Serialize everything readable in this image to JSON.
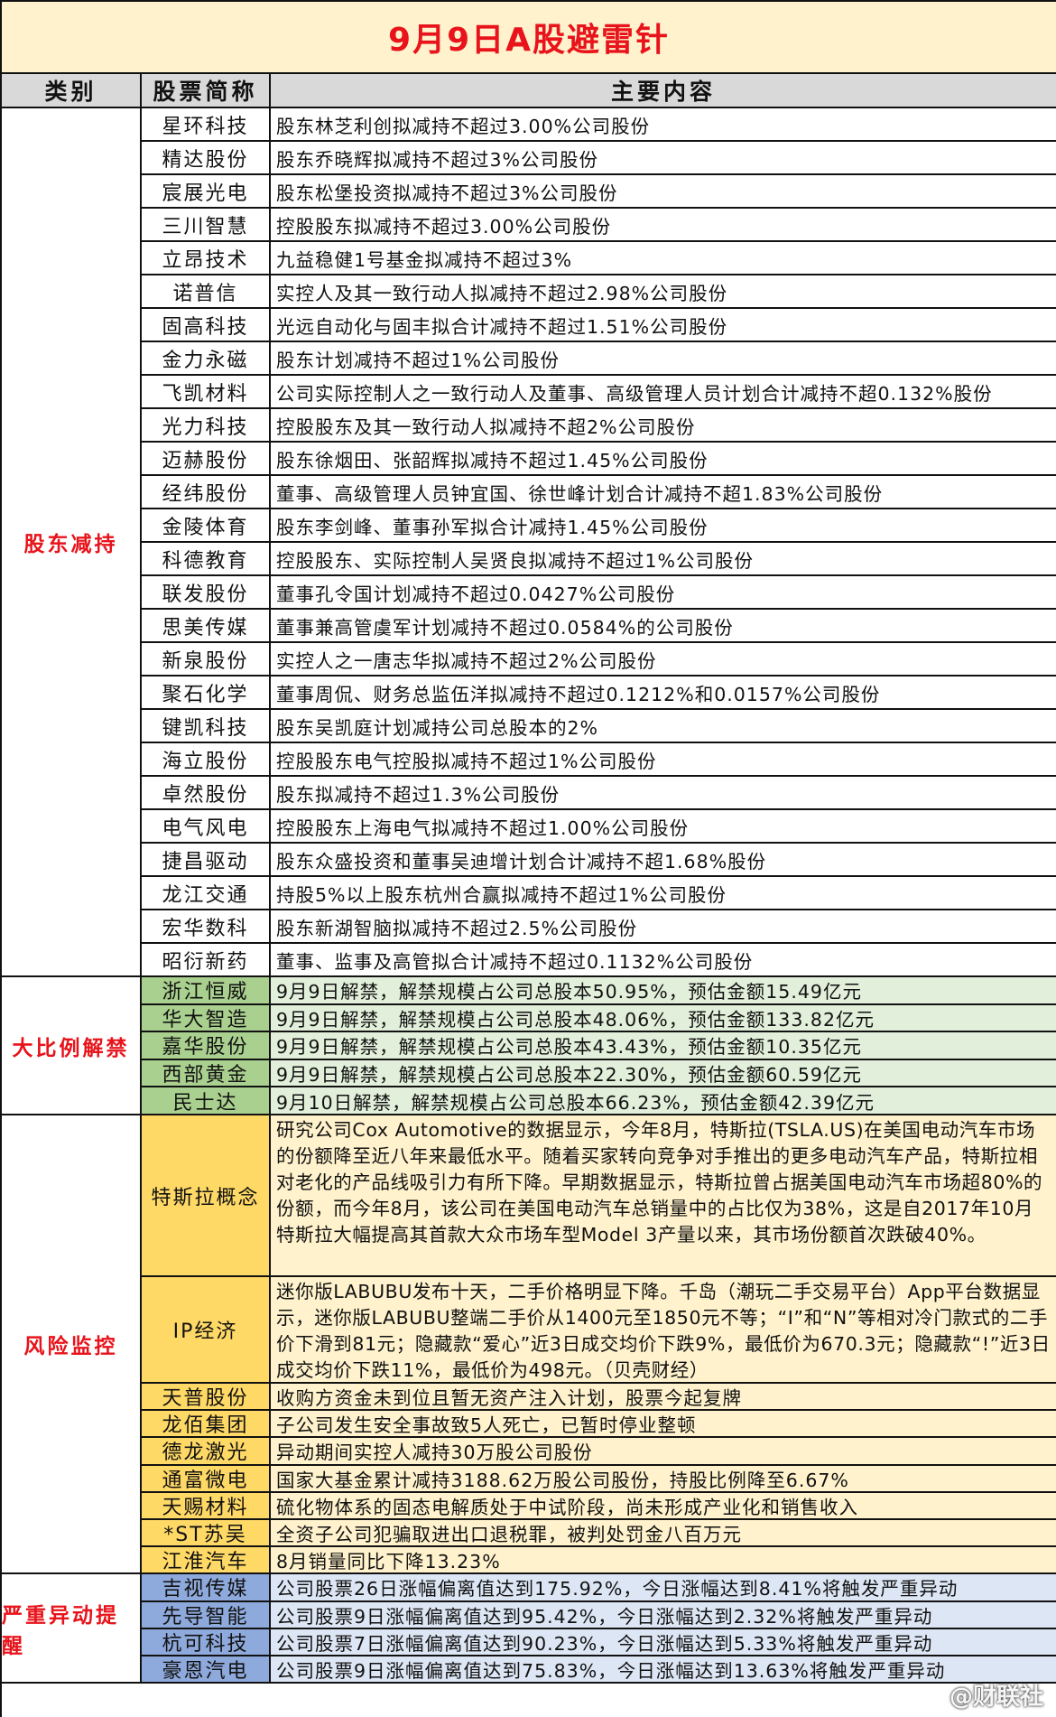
{
  "title": "9月9日A股避雷针",
  "headers": {
    "category": "类别",
    "stock": "股票简称",
    "content": "主要内容"
  },
  "colors": {
    "title_text": "#e8131b",
    "category_text": "#e8131b",
    "header_bg": "#d9d9d9",
    "group_shareholder_bg": "#ffffff",
    "group_unlock_bg": "#a9d08e",
    "group_risk_bg": "#ffd966",
    "group_abnormal_bg": "#8ea9db"
  },
  "groups": [
    {
      "category": "股东减持",
      "rows": [
        {
          "name": "星环科技",
          "content": "股东林芝利创拟减持不超过3.00%公司股份"
        },
        {
          "name": "精达股份",
          "content": "股东乔晓辉拟减持不超过3%公司股份"
        },
        {
          "name": "宸展光电",
          "content": "股东松堡投资拟减持不超过3%公司股份"
        },
        {
          "name": "三川智慧",
          "content": "控股股东拟减持不超过3.00%公司股份"
        },
        {
          "name": "立昂技术",
          "content": "九益稳健1号基金拟减持不超过3%"
        },
        {
          "name": "诺普信",
          "content": "实控人及其一致行动人拟减持不超过2.98%公司股份"
        },
        {
          "name": "固高科技",
          "content": "光远自动化与固丰拟合计减持不超过1.51%公司股份"
        },
        {
          "name": "金力永磁",
          "content": "股东计划减持不超过1%公司股份"
        },
        {
          "name": "飞凯材料",
          "content": "公司实际控制人之一致行动人及董事、高级管理人员计划合计减持不超0.132%股份"
        },
        {
          "name": "光力科技",
          "content": "控股股东及其一致行动人拟减持不超2%公司股份"
        },
        {
          "name": "迈赫股份",
          "content": "股东徐烟田、张韶辉拟减持不超过1.45%公司股份"
        },
        {
          "name": "经纬股份",
          "content": "董事、高级管理人员钟宜国、徐世峰计划合计减持不超1.83%公司股份"
        },
        {
          "name": "金陵体育",
          "content": "股东李剑峰、董事孙军拟合计减持1.45%公司股份"
        },
        {
          "name": "科德教育",
          "content": "控股股东、实际控制人吴贤良拟减持不超过1%公司股份"
        },
        {
          "name": "联发股份",
          "content": "董事孔令国计划减持不超过0.0427%公司股份"
        },
        {
          "name": "思美传媒",
          "content": "董事兼高管虞军计划减持不超过0.0584%的公司股份"
        },
        {
          "name": "新泉股份",
          "content": "实控人之一唐志华拟减持不超过2%公司股份"
        },
        {
          "name": "聚石化学",
          "content": "董事周侃、财务总监伍洋拟减持不超过0.1212%和0.0157%公司股份"
        },
        {
          "name": "键凯科技",
          "content": "股东吴凯庭计划减持公司总股本的2%"
        },
        {
          "name": "海立股份",
          "content": "控股股东电气控股拟减持不超过1%公司股份"
        },
        {
          "name": "卓然股份",
          "content": "股东拟减持不超过1.3%公司股份"
        },
        {
          "name": "电气风电",
          "content": "控股股东上海电气拟减持不超过1.00%公司股份"
        },
        {
          "name": "捷昌驱动",
          "content": "股东众盛投资和董事吴迪增计划合计减持不超1.68%股份"
        },
        {
          "name": "龙江交通",
          "content": "持股5%以上股东杭州合赢拟减持不超过1%公司股份"
        },
        {
          "name": "宏华数科",
          "content": "股东新湖智脑拟减持不超过2.5%公司股份"
        },
        {
          "name": "昭衍新药",
          "content": "董事、监事及高管拟合计减持不超过0.1132%公司股份"
        }
      ]
    },
    {
      "category": "大比例解禁",
      "rows": [
        {
          "name": "浙江恒威",
          "content": "9月9日解禁，解禁规模占公司总股本50.95%，预估金额15.49亿元"
        },
        {
          "name": "华大智造",
          "content": "9月9日解禁，解禁规模占公司总股本48.06%，预估金额133.82亿元"
        },
        {
          "name": "嘉华股份",
          "content": "9月9日解禁，解禁规模占公司总股本43.43%，预估金额10.35亿元"
        },
        {
          "name": "西部黄金",
          "content": "9月9日解禁，解禁规模占公司总股本22.30%，预估金额60.59亿元"
        },
        {
          "name": "民士达",
          "content": "9月10日解禁，解禁规模占公司总股本66.23%，预估金额42.39亿元"
        }
      ]
    },
    {
      "category": "风险监控",
      "rows": [
        {
          "name": "特斯拉概念",
          "content": "研究公司Cox Automotive的数据显示，今年8月，特斯拉(TSLA.US)在美国电动汽车市场的份额降至近八年来最低水平。随着买家转向竞争对手推出的更多电动汽车产品，特斯拉相对老化的产品线吸引力有所下降。早期数据显示，特斯拉曾占据美国电动汽车市场超80%的份额，而今年8月，该公司在美国电动汽车总销量中的占比仅为38%，这是自2017年10月特斯拉大幅提高其首款大众市场车型Model 3产量以来，其市场份额首次跌破40%。"
        },
        {
          "name": "IP经济",
          "content": "迷你版LABUBU发布十天，二手价格明显下降。千岛（潮玩二手交易平台）App平台数据显示，迷你版LABUBU整端二手价从1400元至1850元不等；“I”和“N”等相对冷门款式的二手价下滑到81元；隐藏款“爱心”近3日成交均价下跌9%，最低价为670.3元；隐藏款“!”近3日成交均价下跌11%，最低价为498元。（贝壳财经）"
        },
        {
          "name": "天普股份",
          "content": "收购方资金未到位且暂无资产注入计划，股票今起复牌"
        },
        {
          "name": "龙佰集团",
          "content": "子公司发生安全事故致5人死亡，已暂时停业整顿"
        },
        {
          "name": "德龙激光",
          "content": "异动期间实控人减持30万股公司股份"
        },
        {
          "name": "通富微电",
          "content": "国家大基金累计减持3188.62万股公司股份，持股比例降至6.67%"
        },
        {
          "name": "天赐材料",
          "content": "硫化物体系的固态电解质处于中试阶段，尚未形成产业化和销售收入"
        },
        {
          "name": "*ST苏吴",
          "content": "全资子公司犯骗取进出口退税罪，被判处罚金八百万元"
        },
        {
          "name": "江淮汽车",
          "content": "8月销量同比下降13.23%"
        }
      ]
    },
    {
      "category": "严重异动提醒",
      "rows": [
        {
          "name": "吉视传媒",
          "content": "公司股票26日涨幅偏离值达到175.92%，今日涨幅达到8.41%将触发严重异动"
        },
        {
          "name": "先导智能",
          "content": "公司股票9日涨幅偏离值达到95.42%，今日涨幅达到2.32%将触发严重异动"
        },
        {
          "name": "杭可科技",
          "content": "公司股票7日涨幅偏离值达到90.23%，今日涨幅达到5.33%将触发严重异动"
        },
        {
          "name": "豪恩汽电",
          "content": "公司股票9日涨幅偏离值达到75.83%，今日涨幅达到13.63%将触发严重异动"
        }
      ]
    }
  ],
  "watermark": "@财联社"
}
